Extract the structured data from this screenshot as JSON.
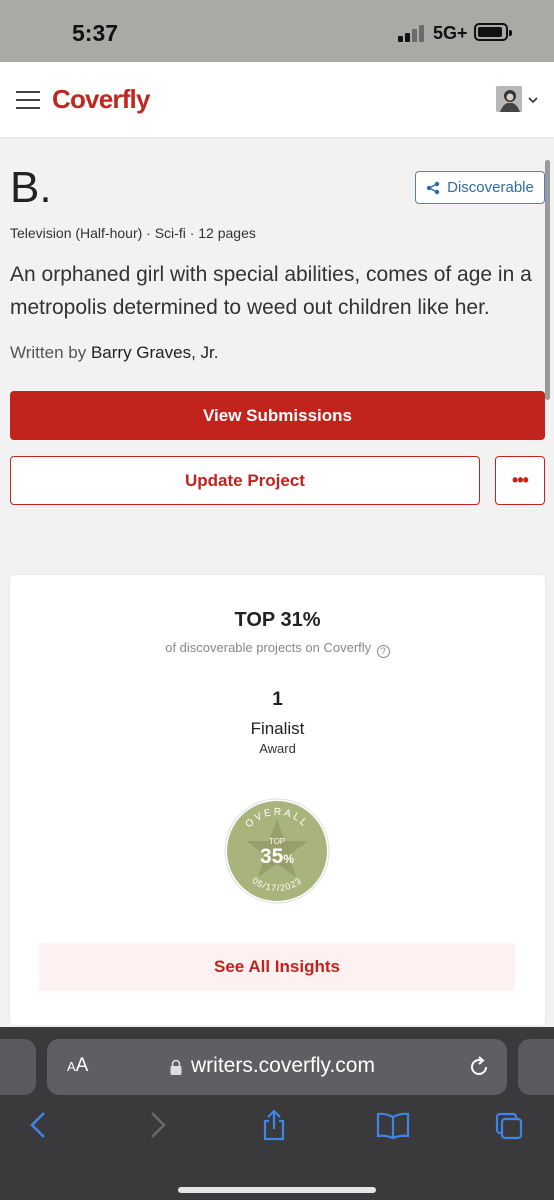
{
  "status_bar": {
    "time": "5:37",
    "network": "5G+",
    "battery_level": 0.8
  },
  "header": {
    "logo": "Coverfly",
    "menu_icon": "hamburger-icon",
    "avatar_icon": "user-avatar",
    "dropdown_icon": "chevron-down-icon"
  },
  "project": {
    "title": "B.",
    "status_label": "Discoverable",
    "meta": "Television (Half-hour) · Sci-fi · 12 pages",
    "logline": "An orphaned girl with special abilities, comes of age in a metropolis determined to weed out children like her.",
    "written_by_prefix": "Written by",
    "author": "Barry Graves, Jr."
  },
  "actions": {
    "view_submissions": "View Submissions",
    "update_project": "Update Project",
    "more_icon": "ellipsis-icon"
  },
  "insights": {
    "rank": "TOP 31%",
    "rank_caption": "of discoverable projects on Coverfly",
    "help_glyph": "?",
    "award_count": "1",
    "award_level": "Finalist",
    "award_type": "Award",
    "badge": {
      "label": "OVERALL",
      "top_label": "TOP",
      "percent_value": "35",
      "percent_sign": "%",
      "date": "05/17/2023",
      "color": "#a9b47c"
    },
    "see_all": "See All Insights"
  },
  "browser": {
    "text_size_label_small": "A",
    "text_size_label_large": "A",
    "url": "writers.coverfly.com",
    "icons": [
      "back-icon",
      "forward-icon",
      "share-icon",
      "bookmarks-icon",
      "tabs-icon"
    ]
  },
  "colors": {
    "brand_red": "#c0241c",
    "link_blue": "#2d6bb0"
  }
}
